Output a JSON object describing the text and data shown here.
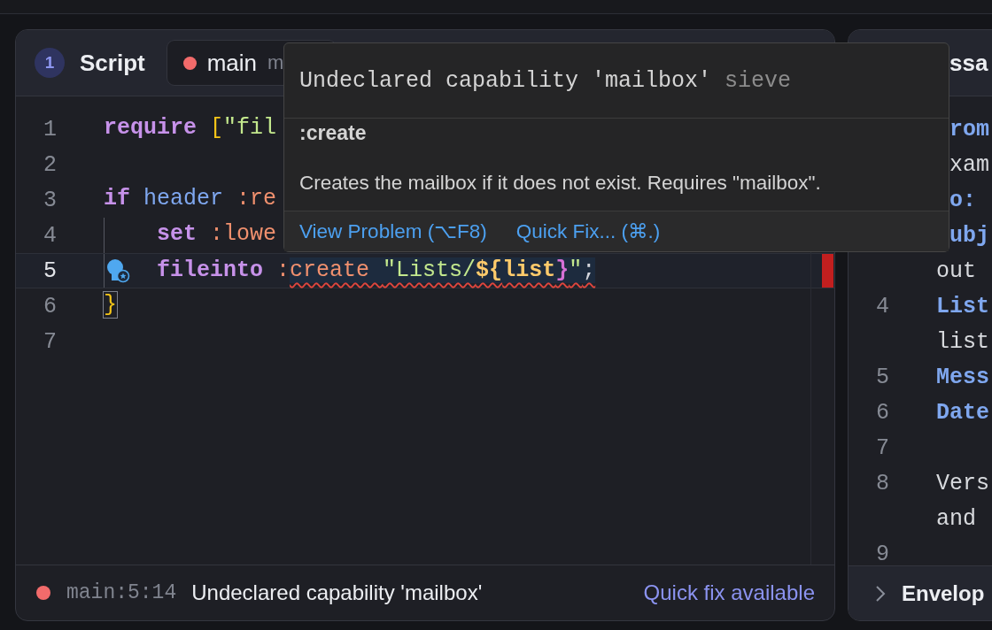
{
  "script_panel": {
    "step": "1",
    "title": "Script",
    "tab": {
      "label": "main",
      "suffix": "m",
      "error": true,
      "selected": true
    },
    "lines": [
      {
        "number": "1",
        "current": false,
        "quick_fix": false,
        "indent": false,
        "tokens": [
          {
            "t": "require ",
            "kind": "kw"
          },
          {
            "t": "[",
            "kind": "br"
          },
          {
            "t": "\"fil",
            "kind": "str"
          }
        ]
      },
      {
        "number": "2",
        "current": false,
        "quick_fix": false,
        "indent": false
      },
      {
        "number": "3",
        "current": false,
        "quick_fix": false,
        "indent": false,
        "tokens": [
          {
            "t": "if ",
            "kind": "kw"
          },
          {
            "t": "header ",
            "kind": "fn"
          },
          {
            "t": ":re",
            "kind": "tag"
          }
        ]
      },
      {
        "number": "4",
        "current": false,
        "quick_fix": false,
        "indent": true,
        "tokens": [
          {
            "t": "set ",
            "kind": "kw"
          },
          {
            "t": ":lowe",
            "kind": "tag"
          }
        ]
      },
      {
        "number": "5",
        "current": true,
        "quick_fix": true,
        "indent": true,
        "tokens": [
          {
            "t": "fileinto ",
            "kind": "kw"
          },
          {
            "t": ":",
            "kind": "tag"
          },
          {
            "t": "create ",
            "kind": "tag",
            "err": true
          },
          {
            "t": "\"Lists/",
            "kind": "str",
            "err": true
          },
          {
            "t": "${",
            "kind": "var",
            "err": true
          },
          {
            "t": "list",
            "kind": "var",
            "err": true
          },
          {
            "t": "}",
            "kind": "br2",
            "err": true
          },
          {
            "t": "\"",
            "kind": "str",
            "err": true
          },
          {
            "t": ";",
            "kind": "punct",
            "err": true
          }
        ]
      },
      {
        "number": "6",
        "current": false,
        "quick_fix": false,
        "indent": false,
        "tokens": [
          {
            "t": "}",
            "kind": "br",
            "matched": true
          }
        ]
      },
      {
        "number": "7",
        "current": false,
        "quick_fix": false,
        "indent": false
      }
    ],
    "status": {
      "error": true,
      "location": "main:5:14",
      "message": "Undeclared capability 'mailbox'",
      "action": "Quick fix available"
    }
  },
  "hover": {
    "title": "Undeclared capability 'mailbox'",
    "source": "sieve",
    "term": ":create",
    "description": "Creates the mailbox if it does not exist. Requires \"mailbox\".",
    "actions": [
      "View Problem (⌥F8)",
      "Quick Fix... (⌘.)"
    ]
  },
  "message_panel": {
    "title": "ssa",
    "footer": "Envelop",
    "lines": [
      {
        "kind": "partial",
        "tokens": [
          {
            "t": "rom",
            "kind": "field"
          }
        ]
      },
      {
        "kind": "partial",
        "tokens": [
          {
            "t": "xam",
            "kind": "text"
          }
        ]
      },
      {
        "kind": "partial",
        "tokens": [
          {
            "t": "o:",
            "kind": "field"
          }
        ]
      },
      {
        "kind": "partial",
        "tokens": [
          {
            "t": "ubj",
            "kind": "field"
          }
        ]
      },
      {
        "kind": "wrap",
        "tokens": [
          {
            "t": "out",
            "kind": "text"
          }
        ]
      },
      {
        "kind": "line",
        "number": "4",
        "tokens": [
          {
            "t": "List",
            "kind": "field"
          }
        ]
      },
      {
        "kind": "wrap",
        "tokens": [
          {
            "t": "list",
            "kind": "text"
          }
        ]
      },
      {
        "kind": "line",
        "number": "5",
        "tokens": [
          {
            "t": "Mess",
            "kind": "field"
          }
        ]
      },
      {
        "kind": "line",
        "number": "6",
        "tokens": [
          {
            "t": "Date",
            "kind": "field"
          }
        ]
      },
      {
        "kind": "line",
        "number": "7"
      },
      {
        "kind": "line",
        "number": "8",
        "tokens": [
          {
            "t": "Vers",
            "kind": "text"
          }
        ]
      },
      {
        "kind": "wrap",
        "tokens": [
          {
            "t": "and",
            "kind": "text"
          }
        ]
      },
      {
        "kind": "line",
        "number": "9"
      }
    ]
  }
}
